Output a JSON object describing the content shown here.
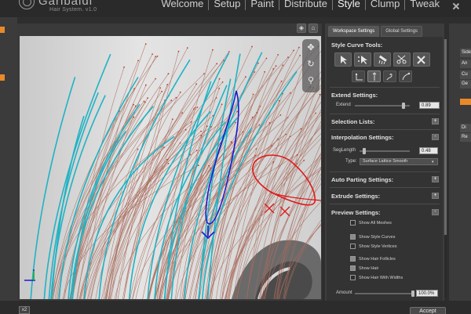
{
  "app": {
    "brand": "Garibaldi",
    "subtitle": "Hair System.   v1.0"
  },
  "nav": {
    "tabs": [
      "Welcome",
      "Setup",
      "Paint",
      "Distribute",
      "Style",
      "Clump",
      "Tweak"
    ],
    "active": "Style"
  },
  "panel": {
    "tabs": [
      "Workspace Settings",
      "Global Settings"
    ],
    "style_curve_tools": "Style Curve Tools:",
    "extend_settings": "Extend Settings:",
    "extend_label": "Extend",
    "extend_value": "0.89",
    "extend_level": 0.89,
    "selection_lists": "Selection Lists:",
    "interpolation_settings": "Interpolation Settings:",
    "seglength_label": "SegLength",
    "seglength_value": "0.48",
    "seglength_level": 0.1,
    "type_label": "Type:",
    "type_value": "Surface Lattice Smooth",
    "auto_parting": "Auto Parting Settings:",
    "extrude_settings": "Extrude Settings:",
    "preview_settings": "Preview Settings:",
    "checkboxes": [
      {
        "label": "Show All Meshes",
        "checked": false
      },
      {
        "label": "Show Style Curves",
        "checked": true
      },
      {
        "label": "Show Style Vertices",
        "checked": false
      },
      {
        "label": "Show Hair Follicles",
        "checked": true
      },
      {
        "label": "Show Hair",
        "checked": true
      },
      {
        "label": "Show Hair With Widths",
        "checked": false
      }
    ],
    "amount_label": "Amount",
    "amount_value": "100.0%",
    "amount_level": 1.0
  },
  "right_strip": {
    "tabs": [
      "Side",
      "An",
      "Cu",
      "Ge",
      "Di",
      "Re"
    ]
  },
  "bottom": {
    "accept_label": "Accept",
    "left_icon": "x2"
  },
  "colors": {
    "accent": "#e8892a",
    "guide_curves": "#a96b5c",
    "teal_curves": "#1fb3c4",
    "annotation_blue": "#1a1ad0",
    "annotation_red": "#e01818"
  },
  "icons": {
    "vp_top": [
      "target-icon",
      "home-icon"
    ],
    "vp_tools": [
      "move-icon",
      "rotate-icon",
      "zoom-icon"
    ]
  }
}
